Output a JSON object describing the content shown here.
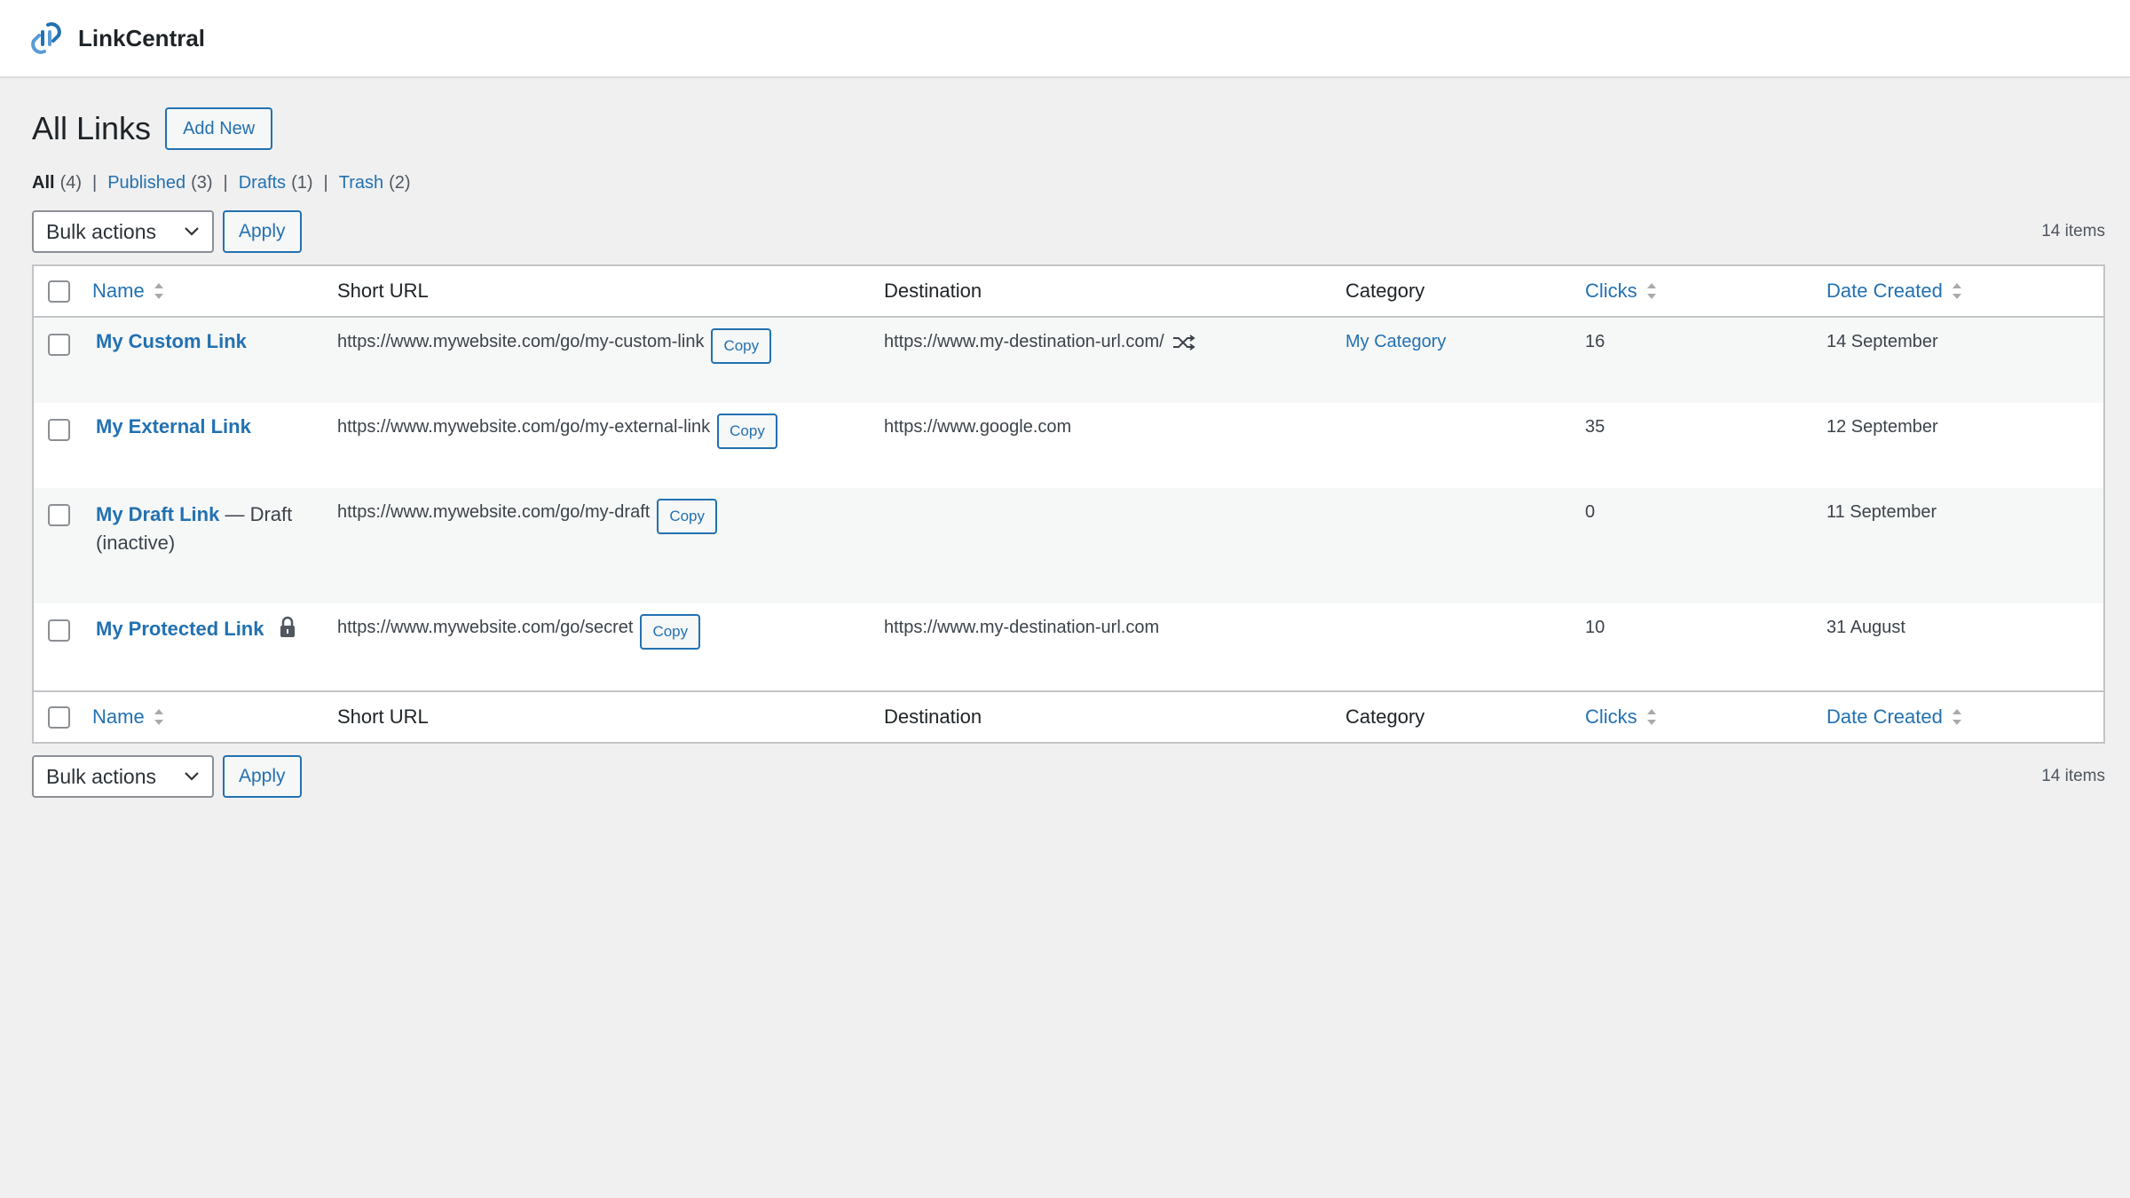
{
  "app": {
    "brand": "LinkCentral"
  },
  "page": {
    "title": "All Links",
    "add_new": "Add New"
  },
  "filters": [
    {
      "label": "All",
      "count": "(4)"
    },
    {
      "label": "Published",
      "count": "(3)"
    },
    {
      "label": "Drafts",
      "count": "(1)"
    },
    {
      "label": "Trash",
      "count": "(2)"
    }
  ],
  "tablenav": {
    "bulk_actions": "Bulk actions",
    "apply": "Apply",
    "items_count": "14 items"
  },
  "columns": {
    "name": "Name",
    "short_url": "Short URL",
    "destination": "Destination",
    "category": "Category",
    "clicks": "Clicks",
    "date_created": "Date Created"
  },
  "copy_label": "Copy",
  "rows": [
    {
      "name": "My Custom Link",
      "state": "",
      "short_url": "https://www.mywebsite.com/go/my-custom-link",
      "destination": "https://www.my-destination-url.com/",
      "category": "My Category",
      "clicks": "16",
      "date": "14 September"
    },
    {
      "name": "My External Link",
      "state": "",
      "short_url": "https://www.mywebsite.com/go/my-external-link",
      "destination": "https://www.google.com",
      "category": "",
      "clicks": "35",
      "date": "12 September"
    },
    {
      "name": "My Draft Link",
      "state": "— Draft (inactive)",
      "short_url": "https://www.mywebsite.com/go/my-draft",
      "destination": "",
      "category": "",
      "clicks": "0",
      "date": "11 September"
    },
    {
      "name": "My Protected Link",
      "state": "",
      "short_url": "https://www.mywebsite.com/go/secret",
      "destination": "https://www.my-destination-url.com",
      "category": "",
      "clicks": "10",
      "date": "31 August"
    }
  ],
  "colors": {
    "accent": "#2271b1",
    "background": "#f0f0f1",
    "text": "#1d2327"
  },
  "icons": [
    "linkcentral-logo-icon",
    "chevron-down-icon",
    "sort-icon",
    "shuffle-icon",
    "lock-icon"
  ]
}
